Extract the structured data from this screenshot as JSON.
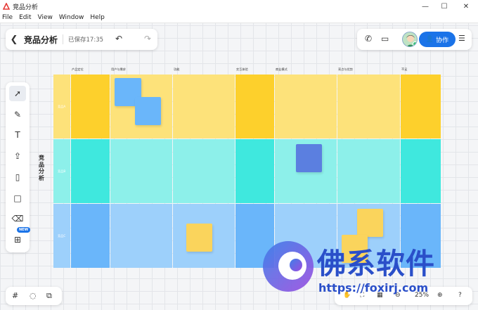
{
  "window": {
    "title": "竞品分析",
    "controls": [
      "minimize-icon",
      "maximize-icon",
      "close-icon"
    ]
  },
  "menu": [
    "File",
    "Edit",
    "View",
    "Window",
    "Help"
  ],
  "doc": {
    "title": "竞品分析",
    "saved": "已保存17:35"
  },
  "header_right": {
    "collab_label": "协作"
  },
  "toolbar": {
    "new_badge": "NEW"
  },
  "board": {
    "title": "竞品分析",
    "columns": [
      "产品定位",
      "用户与需求",
      "功能",
      "交互体验",
      "商业模式",
      "亮点与优势",
      "不足"
    ],
    "rows": [
      "竞品A",
      "竞品B",
      "竞品C"
    ],
    "row_colors": [
      "#fdd02c",
      "#3fe8de",
      "#6ab6fa"
    ]
  },
  "zoom": {
    "level": "25%"
  },
  "watermark": {
    "text": "佛系软件",
    "url": "https://foxirj.com"
  }
}
